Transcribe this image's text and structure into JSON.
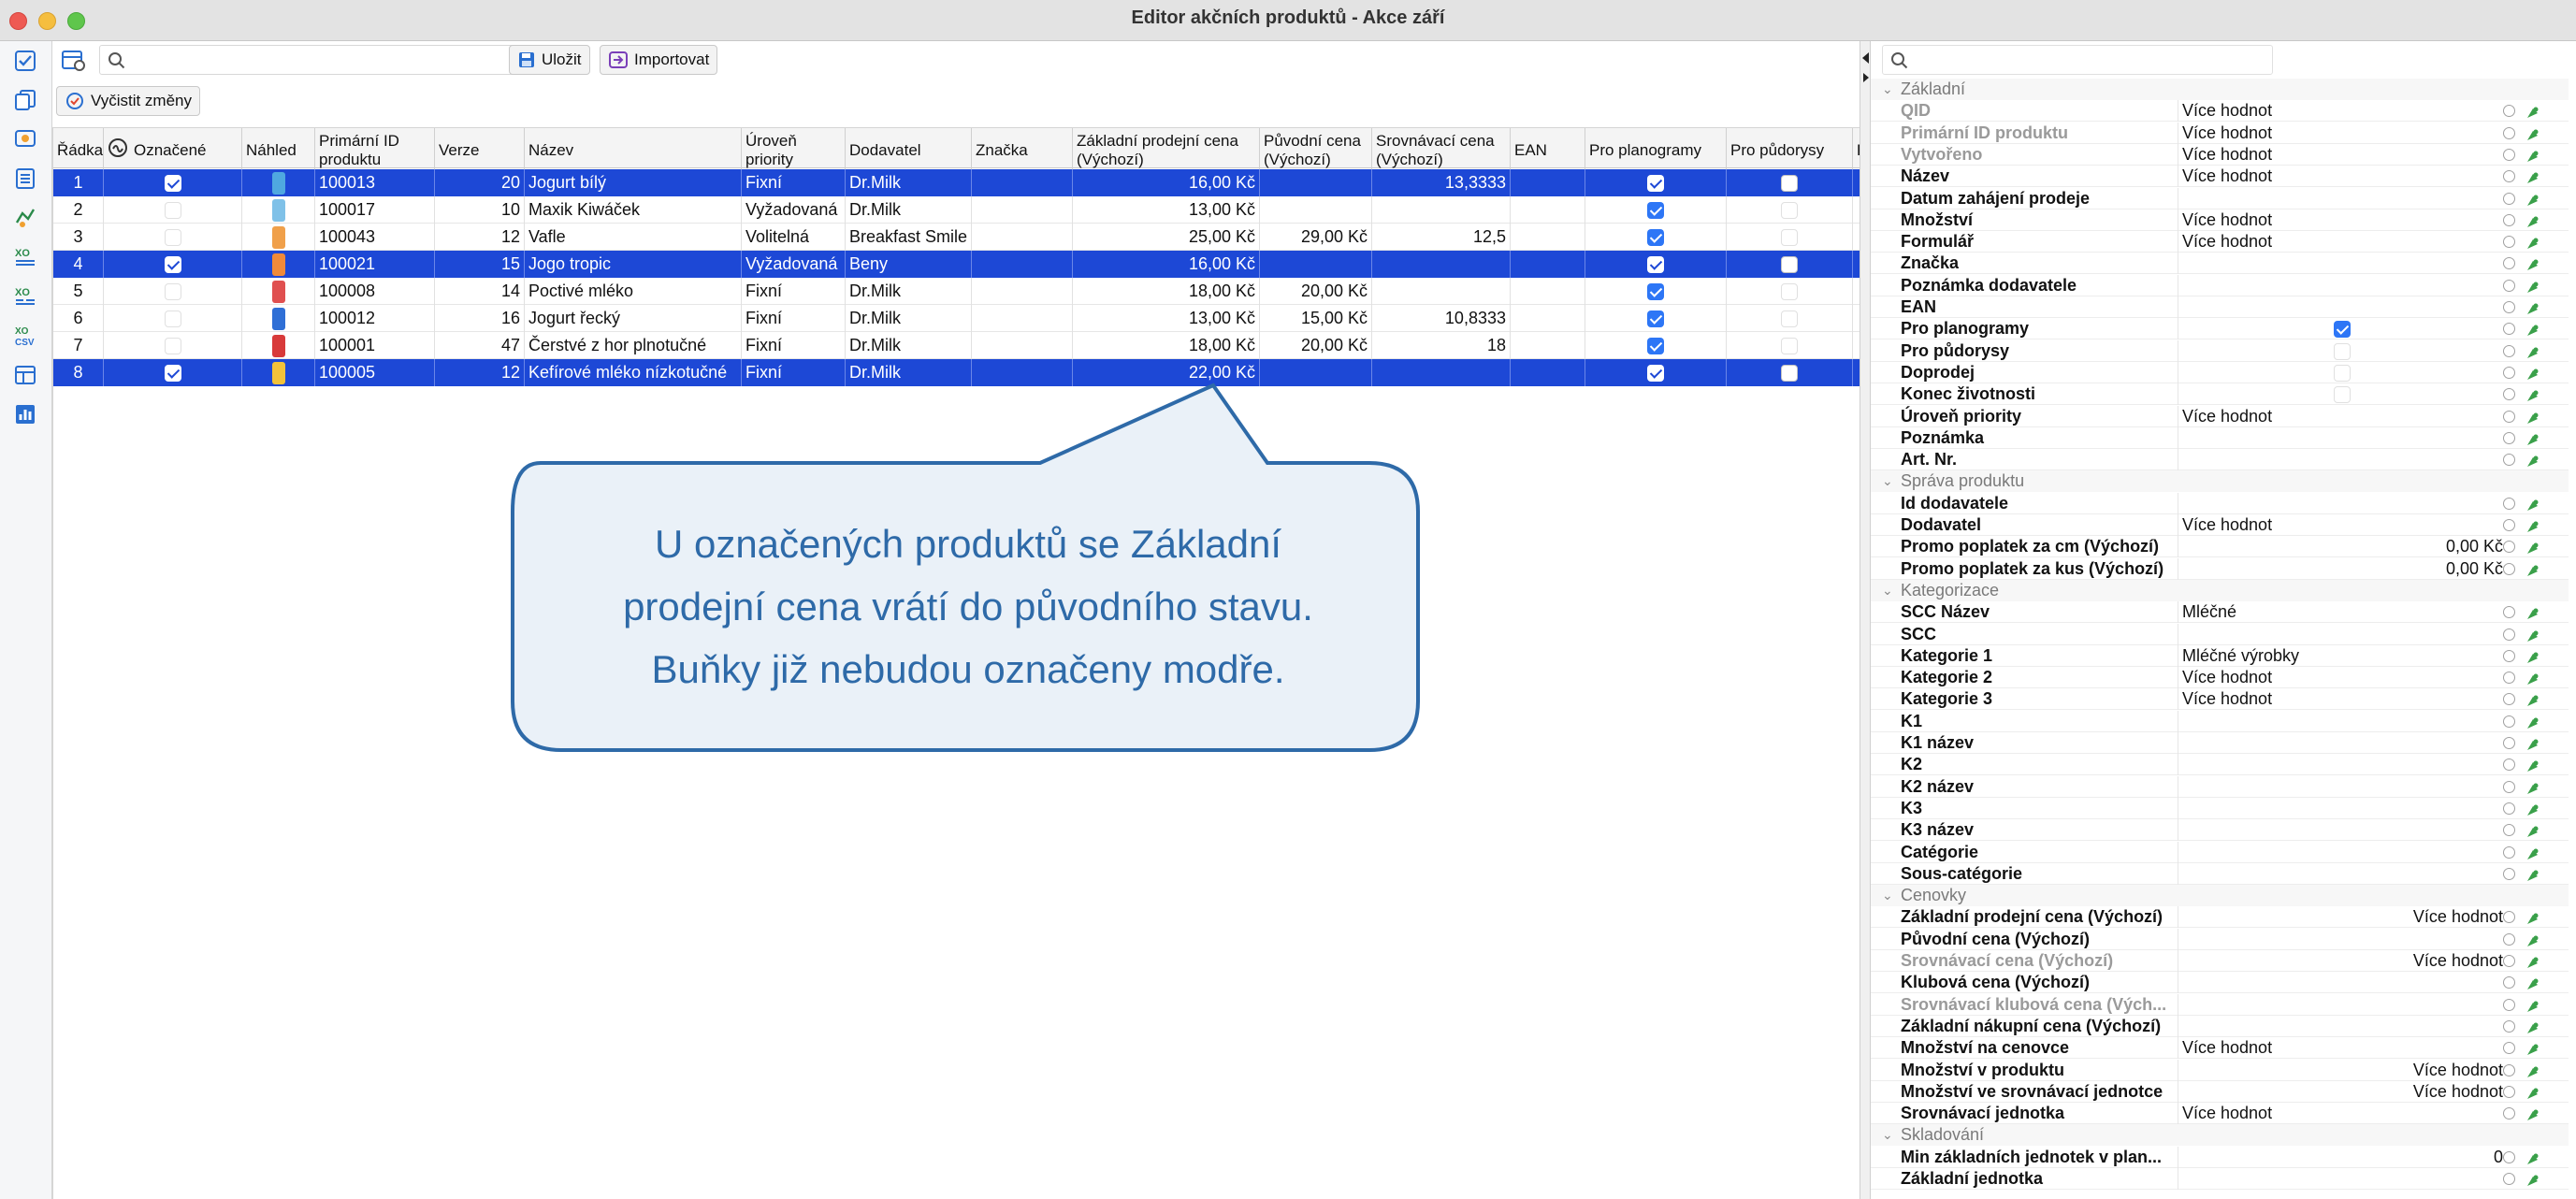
{
  "window": {
    "title": "Editor akčních produktů - Akce září"
  },
  "toolbar": {
    "search_placeholder": "",
    "save_label": "Uložit",
    "import_label": "Importovat",
    "clear_changes_label": "Vyčistit změny"
  },
  "left_toolbar": {
    "icons": [
      "checklist-icon",
      "copy-icon",
      "badge-icon",
      "list-icon",
      "marketing-icon",
      "xo-icon",
      "xo-icon",
      "xo-csv-icon",
      "table-edit-icon",
      "bar-chart-icon"
    ]
  },
  "table": {
    "columns": [
      "Řádka",
      "Označené",
      "Náhled",
      "Primární ID produktu",
      "Verze",
      "Název",
      "Úroveň priority",
      "Dodavatel",
      "Značka",
      "Základní prodejní cena (Výchozí)",
      "Původní cena (Výchozí)",
      "Srovnávací cena (Výchozí)",
      "EAN",
      "Pro planogramy",
      "Pro půdorysy",
      "P"
    ],
    "rows": [
      {
        "row": "1",
        "marked": true,
        "thumb_color": "#4fa8e0",
        "id": "100013",
        "version": "20",
        "name": "Jogurt bílý",
        "priority": "Fixní",
        "supplier": "Dr.Milk",
        "brand": "",
        "base_price": "16,00 Kč",
        "orig_price": "",
        "comp_price": "13,3333",
        "ean": "",
        "planogram": true,
        "floorplan": false,
        "selected": true
      },
      {
        "row": "2",
        "marked": false,
        "thumb_color": "#7fc1e8",
        "id": "100017",
        "version": "10",
        "name": "Maxik Kiwáček",
        "priority": "Vyžadovaná",
        "supplier": "Dr.Milk",
        "brand": "",
        "base_price": "13,00 Kč",
        "orig_price": "",
        "comp_price": "",
        "ean": "",
        "planogram": true,
        "floorplan": false,
        "selected": false
      },
      {
        "row": "3",
        "marked": false,
        "thumb_color": "#f0a04a",
        "id": "100043",
        "version": "12",
        "name": "Vafle",
        "priority": "Volitelná",
        "supplier": "Breakfast Smile",
        "brand": "",
        "base_price": "25,00 Kč",
        "orig_price": "29,00 Kč",
        "comp_price": "12,5",
        "ean": "",
        "planogram": true,
        "floorplan": false,
        "selected": false
      },
      {
        "row": "4",
        "marked": true,
        "thumb_color": "#f08a3a",
        "id": "100021",
        "version": "15",
        "name": "Jogo tropic",
        "priority": "Vyžadovaná",
        "supplier": "Beny",
        "brand": "",
        "base_price": "16,00 Kč",
        "orig_price": "",
        "comp_price": "",
        "ean": "",
        "planogram": true,
        "floorplan": false,
        "selected": true
      },
      {
        "row": "5",
        "marked": false,
        "thumb_color": "#e05050",
        "id": "100008",
        "version": "14",
        "name": "Poctivé mléko",
        "priority": "Fixní",
        "supplier": "Dr.Milk",
        "brand": "",
        "base_price": "18,00 Kč",
        "orig_price": "20,00 Kč",
        "comp_price": "",
        "ean": "",
        "planogram": true,
        "floorplan": false,
        "selected": false
      },
      {
        "row": "6",
        "marked": false,
        "thumb_color": "#2f6fd6",
        "id": "100012",
        "version": "16",
        "name": "Jogurt řecký",
        "priority": "Fixní",
        "supplier": "Dr.Milk",
        "brand": "",
        "base_price": "13,00 Kč",
        "orig_price": "15,00 Kč",
        "comp_price": "10,8333",
        "ean": "",
        "planogram": true,
        "floorplan": false,
        "selected": false
      },
      {
        "row": "7",
        "marked": false,
        "thumb_color": "#d83a3a",
        "id": "100001",
        "version": "47",
        "name": "Čerstvé z hor plnotučné",
        "priority": "Fixní",
        "supplier": "Dr.Milk",
        "brand": "",
        "base_price": "18,00 Kč",
        "orig_price": "20,00 Kč",
        "comp_price": "18",
        "ean": "",
        "planogram": true,
        "floorplan": false,
        "selected": false
      },
      {
        "row": "8",
        "marked": true,
        "thumb_color": "#f2c23a",
        "id": "100005",
        "version": "12",
        "name": "Kefírové mléko nízkotučné",
        "priority": "Fixní",
        "supplier": "Dr.Milk",
        "brand": "",
        "base_price": "22,00 Kč",
        "orig_price": "",
        "comp_price": "",
        "ean": "",
        "planogram": true,
        "floorplan": false,
        "selected": true
      }
    ]
  },
  "callout": {
    "lines": [
      "U označených produktů se Základní",
      "prodejní cena vrátí do původního stavu.",
      "Buňky již nebudou označeny modře."
    ]
  },
  "properties": {
    "search_placeholder": "",
    "items": [
      {
        "type": "section",
        "label": "Základní"
      },
      {
        "type": "prop",
        "name": "QID",
        "value": "Více hodnot",
        "disabled": true
      },
      {
        "type": "prop",
        "name": "Primární ID produktu",
        "value": "Více hodnot",
        "disabled": true
      },
      {
        "type": "prop",
        "name": "Vytvořeno",
        "value": "Více hodnot",
        "disabled": true
      },
      {
        "type": "prop",
        "name": "Název",
        "value": "Více hodnot"
      },
      {
        "type": "prop",
        "name": "Datum zahájení prodeje",
        "value": ""
      },
      {
        "type": "prop",
        "name": "Množství",
        "value": "Více hodnot"
      },
      {
        "type": "prop",
        "name": "Formulář",
        "value": "Více hodnot"
      },
      {
        "type": "prop",
        "name": "Značka",
        "value": ""
      },
      {
        "type": "prop",
        "name": "Poznámka dodavatele",
        "value": ""
      },
      {
        "type": "prop",
        "name": "EAN",
        "value": ""
      },
      {
        "type": "prop",
        "name": "Pro planogramy",
        "value": "",
        "checkbox": "on"
      },
      {
        "type": "prop",
        "name": "Pro půdorysy",
        "value": "",
        "checkbox": "off"
      },
      {
        "type": "prop",
        "name": "Doprodej",
        "value": "",
        "checkbox": "off"
      },
      {
        "type": "prop",
        "name": "Konec životnosti",
        "value": "",
        "checkbox": "off"
      },
      {
        "type": "prop",
        "name": "Úroveň priority",
        "value": "Více hodnot"
      },
      {
        "type": "prop",
        "name": "Poznámka",
        "value": ""
      },
      {
        "type": "prop",
        "name": "Art. Nr.",
        "value": ""
      },
      {
        "type": "section",
        "label": "Správa produktu"
      },
      {
        "type": "prop",
        "name": "Id dodavatele",
        "value": ""
      },
      {
        "type": "prop",
        "name": "Dodavatel",
        "value": "Více hodnot"
      },
      {
        "type": "prop",
        "name": "Promo poplatek za cm (Výchozí)",
        "value": "0,00 Kč",
        "right": true
      },
      {
        "type": "prop",
        "name": "Promo poplatek za kus (Výchozí)",
        "value": "0,00 Kč",
        "right": true
      },
      {
        "type": "section",
        "label": "Kategorizace"
      },
      {
        "type": "prop",
        "name": "SCC Název",
        "value": "Mléčné"
      },
      {
        "type": "prop",
        "name": "SCC",
        "value": ""
      },
      {
        "type": "prop",
        "name": "Kategorie 1",
        "value": "Mléčné výrobky"
      },
      {
        "type": "prop",
        "name": "Kategorie 2",
        "value": "Více hodnot"
      },
      {
        "type": "prop",
        "name": "Kategorie 3",
        "value": "Více hodnot"
      },
      {
        "type": "prop",
        "name": "K1",
        "value": ""
      },
      {
        "type": "prop",
        "name": "K1 název",
        "value": ""
      },
      {
        "type": "prop",
        "name": "K2",
        "value": ""
      },
      {
        "type": "prop",
        "name": "K2 název",
        "value": ""
      },
      {
        "type": "prop",
        "name": "K3",
        "value": ""
      },
      {
        "type": "prop",
        "name": "K3 název",
        "value": ""
      },
      {
        "type": "prop",
        "name": "Catégorie",
        "value": ""
      },
      {
        "type": "prop",
        "name": "Sous-catégorie",
        "value": ""
      },
      {
        "type": "section",
        "label": "Cenovky"
      },
      {
        "type": "prop",
        "name": "Základní prodejní cena (Výchozí)",
        "value": "Více hodnot",
        "right": true
      },
      {
        "type": "prop",
        "name": "Původní cena (Výchozí)",
        "value": ""
      },
      {
        "type": "prop",
        "name": "Srovnávací cena (Výchozí)",
        "value": "Více hodnot",
        "right": true,
        "disabled": true
      },
      {
        "type": "prop",
        "name": "Klubová cena (Výchozí)",
        "value": ""
      },
      {
        "type": "prop",
        "name": "Srovnávací klubová cena (Vých...",
        "value": "",
        "disabled": true
      },
      {
        "type": "prop",
        "name": "Základní nákupní cena (Výchozí)",
        "value": ""
      },
      {
        "type": "prop",
        "name": "Množství na cenovce",
        "value": "Více hodnot"
      },
      {
        "type": "prop",
        "name": "Množství v produktu",
        "value": "Více hodnot",
        "right": true
      },
      {
        "type": "prop",
        "name": "Množství ve srovnávací jednotce",
        "value": "Více hodnot",
        "right": true
      },
      {
        "type": "prop",
        "name": "Srovnávací jednotka",
        "value": "Více hodnot"
      },
      {
        "type": "section",
        "label": "Skladování"
      },
      {
        "type": "prop",
        "name": "Min základních jednotek v plan...",
        "value": "0",
        "right": true
      },
      {
        "type": "prop",
        "name": "Základní jednotka",
        "value": ""
      }
    ]
  },
  "colors": {
    "selection": "#1d48d6",
    "accent": "#2d76f6",
    "callout_fill": "#eaf1f8",
    "callout_stroke": "#2e6aa8"
  }
}
